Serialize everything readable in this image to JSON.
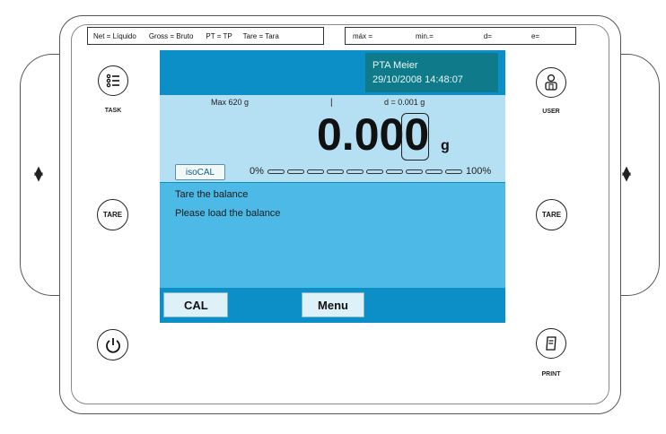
{
  "labels": {
    "net": "Net = Líquido",
    "gross": "Gross = Bruto",
    "pt": "PT = TP",
    "tare": "Tare = Tara",
    "max": "máx =",
    "min": "min.=",
    "d": "d=",
    "e": "e="
  },
  "screen": {
    "user_name": "PTA Meier",
    "datetime": "29/10/2008 14:48:07",
    "max_capacity": "Max 620 g",
    "readability": "d = 0.001 g",
    "weight_main": "0.00",
    "weight_last_digit": "0",
    "unit": "g",
    "isocal_label": "isoCAL",
    "bar_min": "0%",
    "bar_max": "100%",
    "bar_level_percent": 0,
    "message_line1": "Tare the balance",
    "message_line2": "Please load the balance",
    "softkey_cal": "CAL",
    "softkey_menu": "Menu"
  },
  "buttons": {
    "task_label": "TASK",
    "tare_left_text": "TARE",
    "user_label": "USER",
    "tare_right_text": "TARE",
    "print_label": "PRINT"
  },
  "icons": {
    "side_left": "up-down-arrows-icon",
    "side_right": "up-down-arrows-icon",
    "task": "list-icon",
    "user": "user-icon",
    "power": "power-icon",
    "print": "print-icon"
  },
  "colors": {
    "screen_blue": "#0c8fc6",
    "weigh_light_blue": "#b5dff2",
    "message_blue": "#4db9e6",
    "user_box_teal": "#0e7a8a"
  }
}
